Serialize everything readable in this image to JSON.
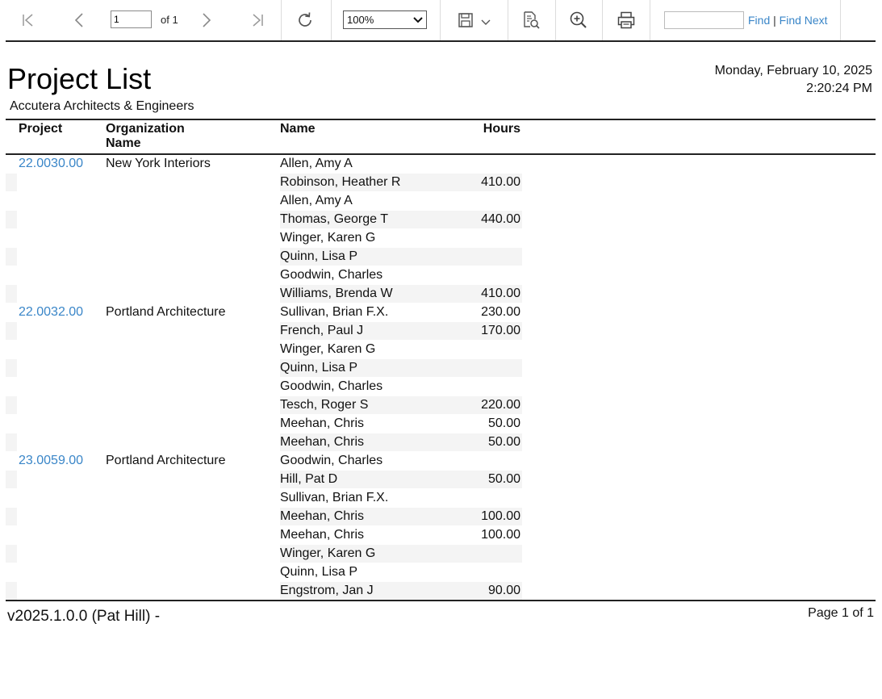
{
  "toolbar": {
    "page_value": "1",
    "of_label": "of 1",
    "zoom_value": "100%",
    "find_label": "Find",
    "find_separator": "|",
    "find_next_label": "Find Next"
  },
  "report": {
    "title": "Project List",
    "organization": "Accutera Architects & Engineers",
    "date": "Monday, February 10, 2025",
    "time": "2:20:24 PM",
    "columns": {
      "project": "Project",
      "organization_line1": "Organization",
      "organization_line2": "Name",
      "name": "Name",
      "hours": "Hours"
    },
    "rows": [
      {
        "project": "22.0030.00",
        "org": "New York Interiors",
        "name": "Allen, Amy A",
        "hours": ""
      },
      {
        "project": "",
        "org": "",
        "name": "Robinson, Heather R",
        "hours": "410.00"
      },
      {
        "project": "",
        "org": "",
        "name": "Allen, Amy A",
        "hours": ""
      },
      {
        "project": "",
        "org": "",
        "name": "Thomas, George T",
        "hours": "440.00"
      },
      {
        "project": "",
        "org": "",
        "name": "Winger, Karen G",
        "hours": ""
      },
      {
        "project": "",
        "org": "",
        "name": "Quinn, Lisa P",
        "hours": ""
      },
      {
        "project": "",
        "org": "",
        "name": "Goodwin, Charles",
        "hours": ""
      },
      {
        "project": "",
        "org": "",
        "name": "Williams, Brenda W",
        "hours": "410.00"
      },
      {
        "project": "22.0032.00",
        "org": "Portland Architecture",
        "name": "Sullivan, Brian F.X.",
        "hours": "230.00"
      },
      {
        "project": "",
        "org": "",
        "name": "French, Paul J",
        "hours": "170.00"
      },
      {
        "project": "",
        "org": "",
        "name": "Winger, Karen G",
        "hours": ""
      },
      {
        "project": "",
        "org": "",
        "name": "Quinn, Lisa P",
        "hours": ""
      },
      {
        "project": "",
        "org": "",
        "name": "Goodwin, Charles",
        "hours": ""
      },
      {
        "project": "",
        "org": "",
        "name": "Tesch, Roger S",
        "hours": "220.00"
      },
      {
        "project": "",
        "org": "",
        "name": "Meehan, Chris",
        "hours": "50.00"
      },
      {
        "project": "",
        "org": "",
        "name": "Meehan, Chris",
        "hours": "50.00"
      },
      {
        "project": "23.0059.00",
        "org": "Portland Architecture",
        "name": "Goodwin, Charles",
        "hours": ""
      },
      {
        "project": "",
        "org": "",
        "name": "Hill, Pat D",
        "hours": "50.00"
      },
      {
        "project": "",
        "org": "",
        "name": "Sullivan, Brian F.X.",
        "hours": ""
      },
      {
        "project": "",
        "org": "",
        "name": "Meehan, Chris",
        "hours": "100.00"
      },
      {
        "project": "",
        "org": "",
        "name": "Meehan, Chris",
        "hours": "100.00"
      },
      {
        "project": "",
        "org": "",
        "name": "Winger, Karen G",
        "hours": ""
      },
      {
        "project": "",
        "org": "",
        "name": "Quinn, Lisa P",
        "hours": ""
      },
      {
        "project": "",
        "org": "",
        "name": "Engstrom, Jan J",
        "hours": "90.00"
      }
    ],
    "footer_version": "v2025.1.0.0 (Pat Hill) -",
    "footer_page": "Page 1 of 1"
  },
  "icons": [
    "first-page-icon",
    "previous-page-icon",
    "next-page-icon",
    "last-page-icon",
    "refresh-icon",
    "chevron-down-icon",
    "save-icon",
    "find-in-document-icon",
    "zoom-in-icon",
    "print-icon"
  ],
  "colors": {
    "link": "#3a86c8",
    "row_shade": "#f4f4f4",
    "rule": "#222222"
  }
}
